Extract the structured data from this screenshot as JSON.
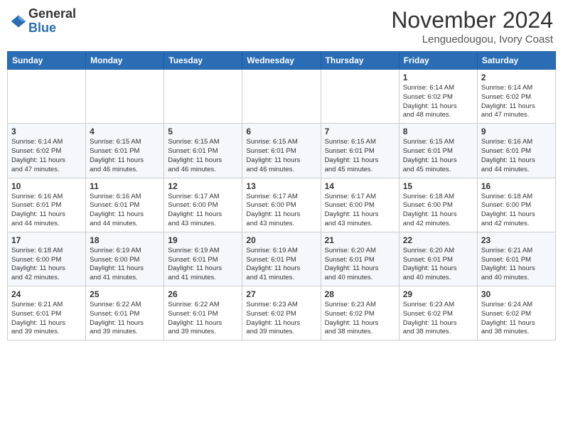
{
  "header": {
    "logo_general": "General",
    "logo_blue": "Blue",
    "month": "November 2024",
    "location": "Lenguedougou, Ivory Coast"
  },
  "weekdays": [
    "Sunday",
    "Monday",
    "Tuesday",
    "Wednesday",
    "Thursday",
    "Friday",
    "Saturday"
  ],
  "weeks": [
    [
      {
        "day": "",
        "info": ""
      },
      {
        "day": "",
        "info": ""
      },
      {
        "day": "",
        "info": ""
      },
      {
        "day": "",
        "info": ""
      },
      {
        "day": "",
        "info": ""
      },
      {
        "day": "1",
        "info": "Sunrise: 6:14 AM\nSunset: 6:02 PM\nDaylight: 11 hours\nand 48 minutes."
      },
      {
        "day": "2",
        "info": "Sunrise: 6:14 AM\nSunset: 6:02 PM\nDaylight: 11 hours\nand 47 minutes."
      }
    ],
    [
      {
        "day": "3",
        "info": "Sunrise: 6:14 AM\nSunset: 6:02 PM\nDaylight: 11 hours\nand 47 minutes."
      },
      {
        "day": "4",
        "info": "Sunrise: 6:15 AM\nSunset: 6:01 PM\nDaylight: 11 hours\nand 46 minutes."
      },
      {
        "day": "5",
        "info": "Sunrise: 6:15 AM\nSunset: 6:01 PM\nDaylight: 11 hours\nand 46 minutes."
      },
      {
        "day": "6",
        "info": "Sunrise: 6:15 AM\nSunset: 6:01 PM\nDaylight: 11 hours\nand 46 minutes."
      },
      {
        "day": "7",
        "info": "Sunrise: 6:15 AM\nSunset: 6:01 PM\nDaylight: 11 hours\nand 45 minutes."
      },
      {
        "day": "8",
        "info": "Sunrise: 6:15 AM\nSunset: 6:01 PM\nDaylight: 11 hours\nand 45 minutes."
      },
      {
        "day": "9",
        "info": "Sunrise: 6:16 AM\nSunset: 6:01 PM\nDaylight: 11 hours\nand 44 minutes."
      }
    ],
    [
      {
        "day": "10",
        "info": "Sunrise: 6:16 AM\nSunset: 6:01 PM\nDaylight: 11 hours\nand 44 minutes."
      },
      {
        "day": "11",
        "info": "Sunrise: 6:16 AM\nSunset: 6:01 PM\nDaylight: 11 hours\nand 44 minutes."
      },
      {
        "day": "12",
        "info": "Sunrise: 6:17 AM\nSunset: 6:00 PM\nDaylight: 11 hours\nand 43 minutes."
      },
      {
        "day": "13",
        "info": "Sunrise: 6:17 AM\nSunset: 6:00 PM\nDaylight: 11 hours\nand 43 minutes."
      },
      {
        "day": "14",
        "info": "Sunrise: 6:17 AM\nSunset: 6:00 PM\nDaylight: 11 hours\nand 43 minutes."
      },
      {
        "day": "15",
        "info": "Sunrise: 6:18 AM\nSunset: 6:00 PM\nDaylight: 11 hours\nand 42 minutes."
      },
      {
        "day": "16",
        "info": "Sunrise: 6:18 AM\nSunset: 6:00 PM\nDaylight: 11 hours\nand 42 minutes."
      }
    ],
    [
      {
        "day": "17",
        "info": "Sunrise: 6:18 AM\nSunset: 6:00 PM\nDaylight: 11 hours\nand 42 minutes."
      },
      {
        "day": "18",
        "info": "Sunrise: 6:19 AM\nSunset: 6:00 PM\nDaylight: 11 hours\nand 41 minutes."
      },
      {
        "day": "19",
        "info": "Sunrise: 6:19 AM\nSunset: 6:01 PM\nDaylight: 11 hours\nand 41 minutes."
      },
      {
        "day": "20",
        "info": "Sunrise: 6:19 AM\nSunset: 6:01 PM\nDaylight: 11 hours\nand 41 minutes."
      },
      {
        "day": "21",
        "info": "Sunrise: 6:20 AM\nSunset: 6:01 PM\nDaylight: 11 hours\nand 40 minutes."
      },
      {
        "day": "22",
        "info": "Sunrise: 6:20 AM\nSunset: 6:01 PM\nDaylight: 11 hours\nand 40 minutes."
      },
      {
        "day": "23",
        "info": "Sunrise: 6:21 AM\nSunset: 6:01 PM\nDaylight: 11 hours\nand 40 minutes."
      }
    ],
    [
      {
        "day": "24",
        "info": "Sunrise: 6:21 AM\nSunset: 6:01 PM\nDaylight: 11 hours\nand 39 minutes."
      },
      {
        "day": "25",
        "info": "Sunrise: 6:22 AM\nSunset: 6:01 PM\nDaylight: 11 hours\nand 39 minutes."
      },
      {
        "day": "26",
        "info": "Sunrise: 6:22 AM\nSunset: 6:01 PM\nDaylight: 11 hours\nand 39 minutes."
      },
      {
        "day": "27",
        "info": "Sunrise: 6:23 AM\nSunset: 6:02 PM\nDaylight: 11 hours\nand 39 minutes."
      },
      {
        "day": "28",
        "info": "Sunrise: 6:23 AM\nSunset: 6:02 PM\nDaylight: 11 hours\nand 38 minutes."
      },
      {
        "day": "29",
        "info": "Sunrise: 6:23 AM\nSunset: 6:02 PM\nDaylight: 11 hours\nand 38 minutes."
      },
      {
        "day": "30",
        "info": "Sunrise: 6:24 AM\nSunset: 6:02 PM\nDaylight: 11 hours\nand 38 minutes."
      }
    ]
  ]
}
